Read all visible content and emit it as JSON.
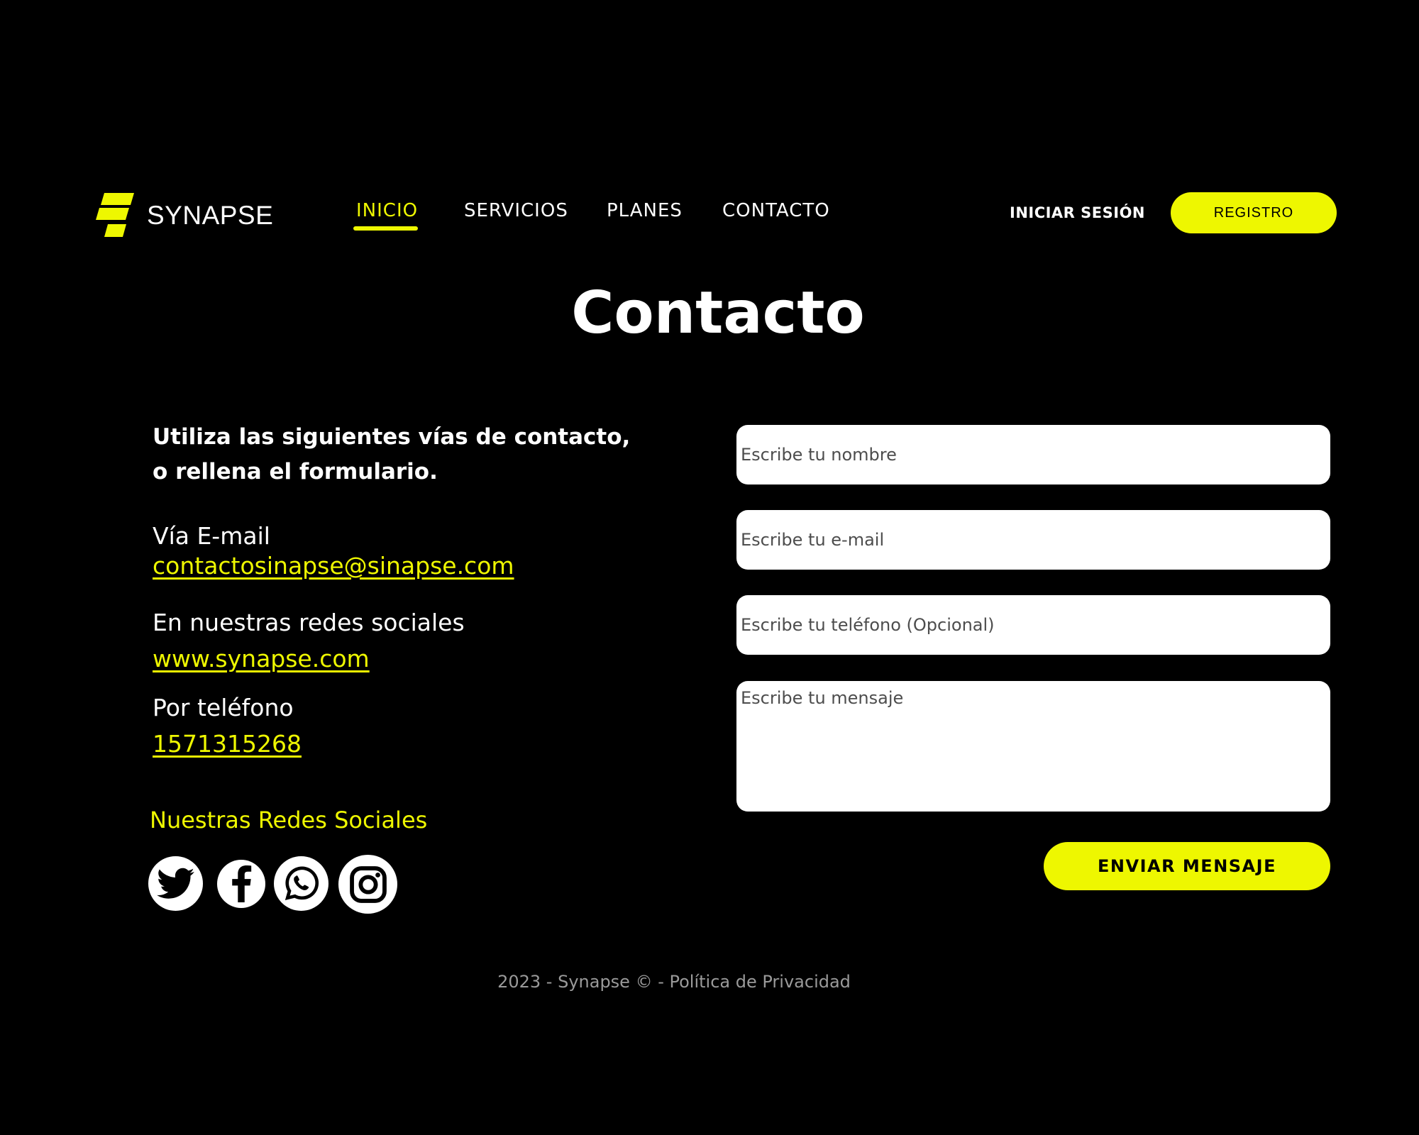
{
  "brand": {
    "name": "SYNAPSE",
    "logo_icon": "synapse-logo-icon",
    "accent_color": "#eef700"
  },
  "nav": {
    "items": [
      {
        "label": "INICIO",
        "active": true
      },
      {
        "label": "SERVICIOS",
        "active": false
      },
      {
        "label": "PLANES",
        "active": false
      },
      {
        "label": "CONTACTO",
        "active": false
      }
    ],
    "login_label": "INICIAR SESIÓN",
    "register_label": "REGISTRO"
  },
  "page": {
    "title": "Contacto"
  },
  "contact_info": {
    "intro_line1": "Utiliza las siguientes vías de contacto,",
    "intro_line2": "o rellena el formulario.",
    "email_label": "Vía E-mail",
    "email_value": "contactosinapse@sinapse.com",
    "social_label": "En nuestras redes sociales",
    "website_value": "www.synapse.com",
    "phone_label": "Por teléfono",
    "phone_value": "1571315268"
  },
  "social": {
    "heading": "Nuestras Redes Sociales",
    "icons": [
      "twitter-icon",
      "facebook-icon",
      "whatsapp-icon",
      "instagram-icon"
    ]
  },
  "form": {
    "name_placeholder": "Escribe tu nombre",
    "email_placeholder": "Escribe tu e-mail",
    "phone_placeholder": "Escribe tu teléfono (Opcional)",
    "message_placeholder": "Escribe tu mensaje",
    "submit_label": "ENVIAR MENSAJE"
  },
  "footer": {
    "text": "2023 - Synapse © - Política de Privacidad"
  }
}
